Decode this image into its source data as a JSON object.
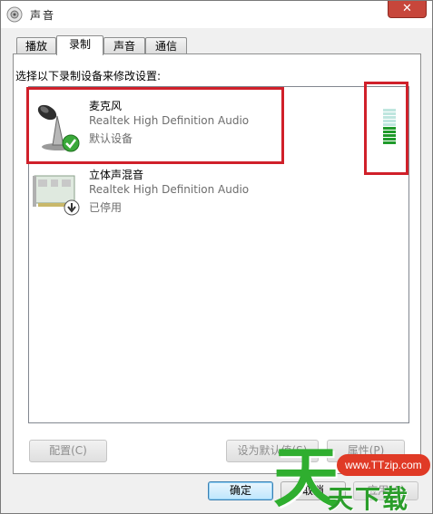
{
  "window": {
    "title": "声音",
    "close_label": "✕"
  },
  "tabs": [
    {
      "label": "播放",
      "active": false
    },
    {
      "label": "录制",
      "active": true
    },
    {
      "label": "声音",
      "active": false
    },
    {
      "label": "通信",
      "active": false
    }
  ],
  "instructions": "选择以下录制设备来修改设置:",
  "devices": [
    {
      "name": "麦克风",
      "description": "Realtek High Definition Audio",
      "status": "默认设备",
      "icon": "microphone-icon",
      "badge": "check-icon"
    },
    {
      "name": "立体声混音",
      "description": "Realtek High Definition Audio",
      "status": "已停用",
      "icon": "sound-card-icon",
      "badge": "disabled-arrow-icon"
    }
  ],
  "level_meter": {
    "segments": 10,
    "lit_segments": 5,
    "lit_color": "#1f9a2a",
    "unlit_color": "#bfe6df"
  },
  "buttons": {
    "configure": "配置(C)",
    "set_default": "设为默认值(S)",
    "properties": "属性(P)",
    "ok": "确定",
    "cancel": "取消",
    "apply": "应用(A)"
  },
  "watermark": {
    "url": "www.TTzip.com",
    "text": "天下载",
    "big": "天"
  },
  "colors": {
    "highlight": "#d0202a",
    "close": "#c7463b",
    "watermark_green": "#2fae2f",
    "watermark_red": "#e03a26"
  }
}
